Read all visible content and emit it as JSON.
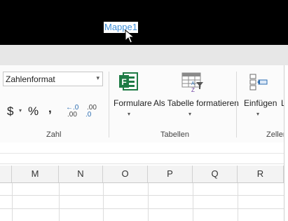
{
  "window": {
    "title": "Mappe1"
  },
  "ribbon": {
    "number_format": {
      "value": "Zahlenformat"
    },
    "currency_symbol": "$",
    "percent_symbol": "%",
    "comma_symbol": ",",
    "increase_decimal_label": ".00",
    "decrease_decimal_label": ".0",
    "increase_decimal_top": "←.0",
    "decrease_decimal_top": ".00",
    "forms_label": "Formulare",
    "format_table_label": "Als Tabelle formatieren",
    "insert_label": "Einfügen",
    "delete_label_partial": "Lö",
    "groups": {
      "number": "Zahl",
      "tables": "Tabellen",
      "cells": "Zellen"
    }
  },
  "sheet": {
    "columns": [
      "M",
      "N",
      "O",
      "P",
      "Q",
      "R"
    ]
  },
  "colors": {
    "title_text": "#3f8fd8",
    "forms_green": "#1e7b45",
    "titlebar": "#000000"
  }
}
